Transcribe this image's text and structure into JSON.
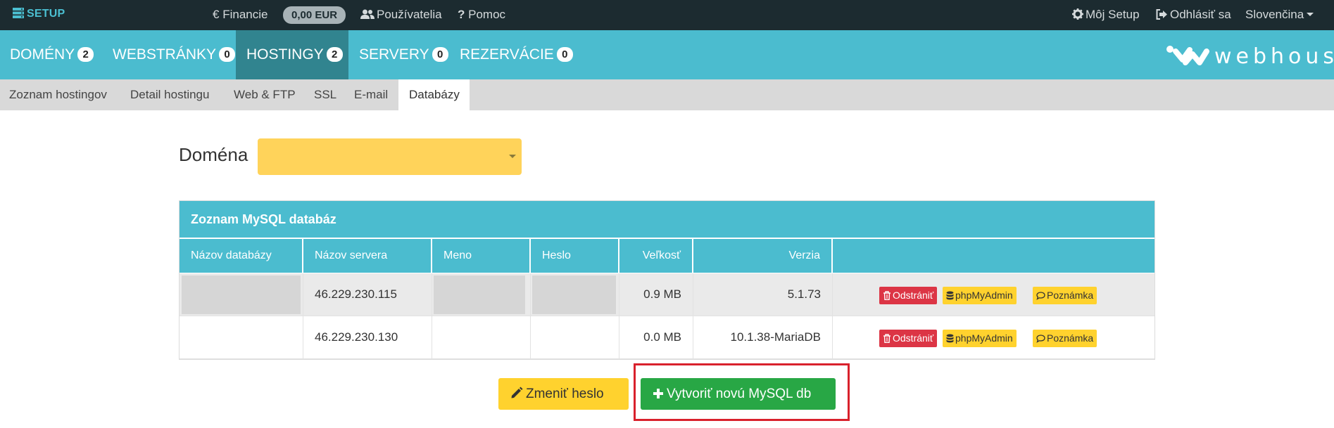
{
  "topbar": {
    "brand": "SETUP",
    "finance": "Financie",
    "balance": "0,00 EUR",
    "users": "Používatelia",
    "help": "Pomoc",
    "my_setup": "Môj Setup",
    "logout": "Odhlásiť sa",
    "language": "Slovenčina"
  },
  "mainnav": [
    {
      "label": "DOMÉNY",
      "badge": "2"
    },
    {
      "label": "WEBSTRÁNKY",
      "badge": "0"
    },
    {
      "label": "HOSTINGY",
      "badge": "2"
    },
    {
      "label": "SERVERY",
      "badge": "0"
    },
    {
      "label": "REZERVÁCIE",
      "badge": "0"
    }
  ],
  "logo_text": "webhouse",
  "subnav": [
    "Zoznam hostingov",
    "Detail hostingu",
    "Web & FTP",
    "SSL",
    "E-mail",
    "Databázy"
  ],
  "domain": {
    "label": "Doména",
    "value": ""
  },
  "panel": {
    "title": "Zoznam MySQL databáz",
    "columns": [
      "Názov databázy",
      "Názov servera",
      "Meno",
      "Heslo",
      "Veľkosť",
      "Verzia",
      ""
    ],
    "rows": [
      {
        "db": "",
        "server": "46.229.230.115",
        "user": "",
        "password": "",
        "size": "0.9 MB",
        "version": "5.1.73"
      },
      {
        "db": "",
        "server": "46.229.230.130",
        "user": "",
        "password": "",
        "size": "0.0 MB",
        "version": "10.1.38-MariaDB"
      }
    ],
    "actions": {
      "delete": "Odstrániť",
      "pma": "phpMyAdmin",
      "note": "Poznámka"
    }
  },
  "buttons": {
    "change_password": "Zmeniť heslo",
    "create_db": "Vytvoriť novú MySQL db"
  },
  "colors": {
    "accent": "#4bbccf",
    "topbar": "#1c2b30",
    "active_tab": "#31848f",
    "warning": "#ffd22e",
    "danger": "#dc3545",
    "success": "#28a745",
    "highlight": "#d9212c"
  }
}
